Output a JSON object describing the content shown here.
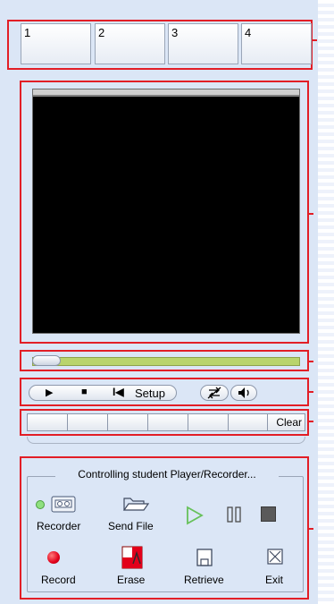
{
  "channels": [
    "1",
    "2",
    "3",
    "4"
  ],
  "transport": {
    "setup_label": "Setup"
  },
  "segments": {
    "clear_label": "Clear"
  },
  "panel": {
    "title": "Controlling student Player/Recorder...",
    "recorder_label": "Recorder",
    "send_file_label": "Send File",
    "record_label": "Record",
    "erase_label": "Erase",
    "retrieve_label": "Retrieve",
    "exit_label": "Exit"
  },
  "colors": {
    "highlight": "#e21e26",
    "panel_bg": "#dbe6f6",
    "progress_track": "#b9d46c",
    "play_green": "#67c15a",
    "record_red": "#e2001a"
  },
  "icons": [
    "recorder-status-led-icon",
    "cassette-icon",
    "folder-icon",
    "play-icon",
    "pause-icon",
    "stop-icon",
    "record-icon",
    "erase-icon",
    "save-disk-icon",
    "close-box-icon",
    "loop-icon",
    "speaker-icon",
    "rewind-icon"
  ]
}
